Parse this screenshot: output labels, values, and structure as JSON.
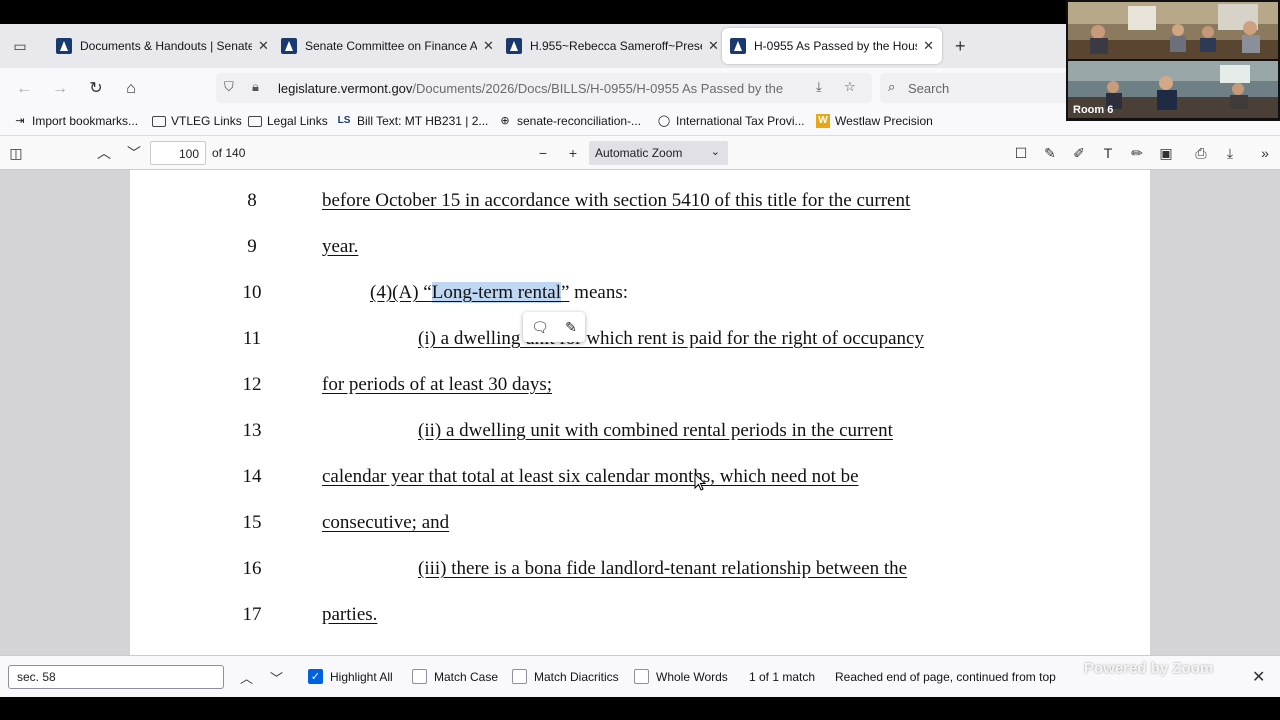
{
  "tabs": [
    {
      "title": "Documents & Handouts | Senate",
      "active": false
    },
    {
      "title": "Senate Committee on Finance Agenda",
      "active": false
    },
    {
      "title": "H.955~Rebecca Sameroff~Presentation",
      "active": false
    },
    {
      "title": "H-0955 As Passed by the House",
      "active": true
    }
  ],
  "nav": {
    "url_domain": "legislature.vermont.gov",
    "url_path": "/Documents/2026/Docs/BILLS/H-0955/H-0955 As Passed by the",
    "search_placeholder": "Search"
  },
  "bookmarks": [
    {
      "label": "Import bookmarks...",
      "icon": "import-icon"
    },
    {
      "label": "VTLEG Links",
      "icon": "folder-icon"
    },
    {
      "label": "Legal Links",
      "icon": "folder-icon"
    },
    {
      "label": "Bill Text: MT HB231 | 2...",
      "icon": "ls-icon",
      "icon_text": "LS"
    },
    {
      "label": "senate-reconciliation-...",
      "icon": "globe-icon"
    },
    {
      "label": "International Tax Provi...",
      "icon": "circle-icon"
    },
    {
      "label": "Westlaw Precision",
      "icon": "westlaw-icon",
      "icon_text": "W"
    }
  ],
  "pdf_toolbar": {
    "page_number": "100",
    "page_count": "of 140",
    "zoom": "Automatic Zoom"
  },
  "document": {
    "lines": [
      {
        "num": "8",
        "segments": [
          {
            "text": "before October 15 in accordance with section 5410 of this title for the current",
            "u": true
          }
        ]
      },
      {
        "num": "9",
        "segments": [
          {
            "text": "year.",
            "u": true
          }
        ]
      },
      {
        "num": "10",
        "segments": [
          {
            "text": "(4)(A)  “",
            "u": true
          },
          {
            "text": "Long-term rental",
            "u": true,
            "hl": true
          },
          {
            "text": "”",
            "u": true
          },
          {
            "text": " means:",
            "u": false
          }
        ]
      },
      {
        "num": "11",
        "segments": [
          {
            "text": "(i)  a dwelling unit for which rent is paid for the right of occupancy",
            "u": true
          }
        ]
      },
      {
        "num": "12",
        "segments": [
          {
            "text": "for periods of at least 30 days;",
            "u": true
          }
        ]
      },
      {
        "num": "13",
        "segments": [
          {
            "text": "(ii)  a dwelling unit with combined rental periods in the current",
            "u": true
          }
        ]
      },
      {
        "num": "14",
        "segments": [
          {
            "text": "calendar year that total at least six calendar months, which need not be",
            "u": true
          }
        ]
      },
      {
        "num": "15",
        "segments": [
          {
            "text": "consecutive; and",
            "u": true
          }
        ]
      },
      {
        "num": "16",
        "segments": [
          {
            "text": "(iii)  there is a bona fide landlord-tenant relationship between the",
            "u": true
          }
        ]
      },
      {
        "num": "17",
        "segments": [
          {
            "text": "parties.",
            "u": true
          }
        ]
      }
    ]
  },
  "findbar": {
    "query": "sec. 58",
    "highlight_all_label": "Highlight All",
    "highlight_all_checked": true,
    "match_case_label": "Match Case",
    "match_diacritics_label": "Match Diacritics",
    "whole_words_label": "Whole Words",
    "match_count": "1 of 1 match",
    "status": "Reached end of page, continued from top"
  },
  "video": {
    "room_label": "Room 6",
    "powered_by": "Powered by Zoom"
  }
}
